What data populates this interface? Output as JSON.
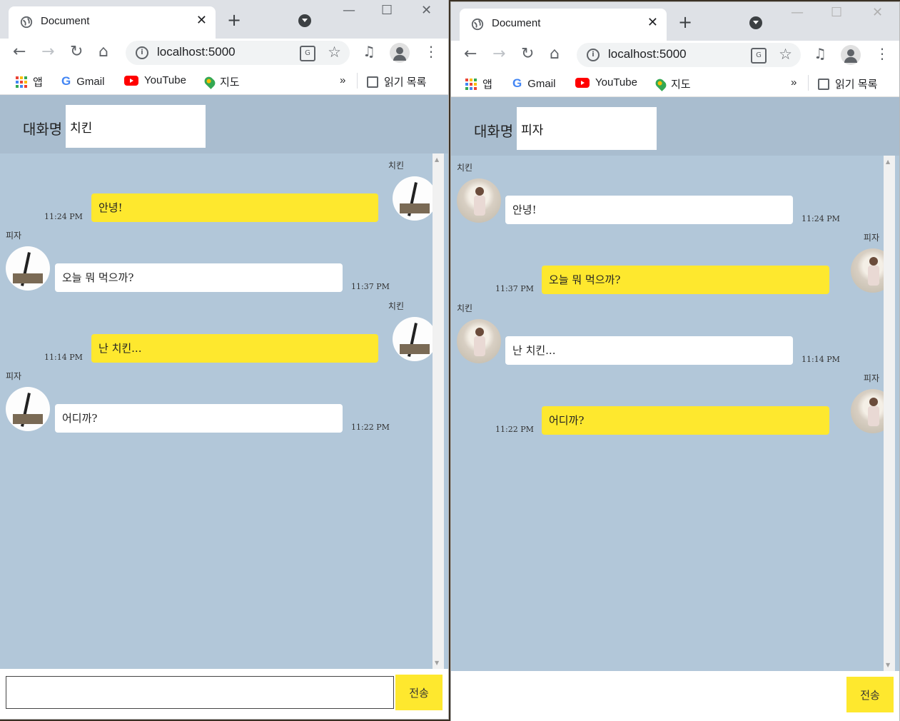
{
  "browser": {
    "tab_title": "Document",
    "url": "localhost:5000",
    "bookmarks": {
      "apps": "앱",
      "gmail": "Gmail",
      "youtube": "YouTube",
      "maps": "지도",
      "reading_list": "읽기 목록"
    }
  },
  "windows": [
    {
      "room_label": "대화명",
      "room_name": "치킨",
      "send_label": "전송",
      "messages": [
        {
          "sender": "치킨",
          "text": "안녕!",
          "time": "11:24 PM"
        },
        {
          "sender": "피자",
          "text": "오늘 뭐 먹으까?",
          "time": "11:37 PM"
        },
        {
          "sender": "치킨",
          "text": "난 치킨...",
          "time": "11:14 PM"
        },
        {
          "sender": "피자",
          "text": "어디까?",
          "time": "11:22 PM"
        }
      ]
    },
    {
      "room_label": "대화명",
      "room_name": "피자",
      "send_label": "전송",
      "messages": [
        {
          "sender": "치킨",
          "text": "안녕!",
          "time": "11:24 PM"
        },
        {
          "sender": "피자",
          "text": "오늘 뭐 먹으까?",
          "time": "11:37 PM"
        },
        {
          "sender": "치킨",
          "text": "난 치킨...",
          "time": "11:14 PM"
        },
        {
          "sender": "피자",
          "text": "어디까?",
          "time": "11:22 PM"
        }
      ]
    }
  ],
  "colors": {
    "chat_bg": "#b2c7d9",
    "my_bubble": "#fee82e",
    "their_bubble": "#ffffff"
  }
}
